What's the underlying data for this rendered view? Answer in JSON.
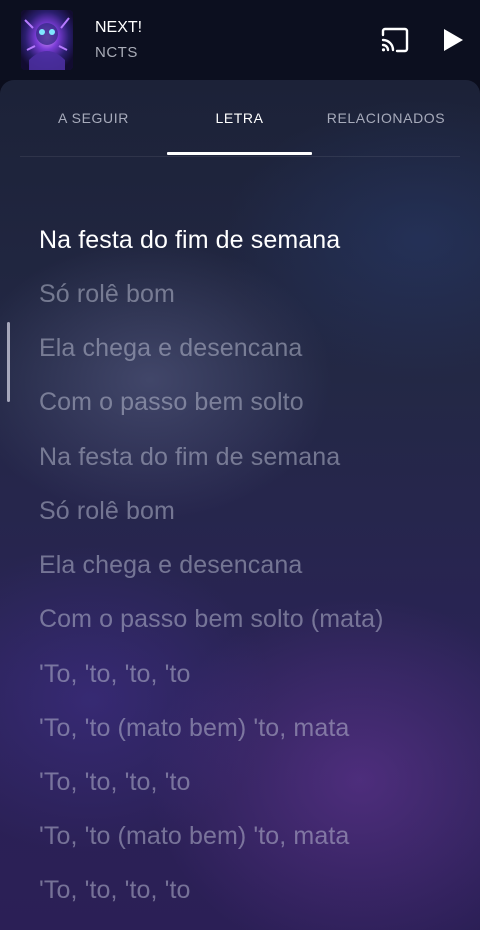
{
  "now_playing": {
    "title": "NEXT!",
    "artist": "NCTS"
  },
  "icons": {
    "cast": "cast-icon",
    "play": "play-icon"
  },
  "tabs": [
    {
      "label": "A SEGUIR",
      "active": false
    },
    {
      "label": "LETRA",
      "active": true
    },
    {
      "label": "RELACIONADOS",
      "active": false
    }
  ],
  "lyrics": [
    {
      "text": "Na festa do fim de semana",
      "current": true
    },
    {
      "text": "Só rolê bom",
      "current": false
    },
    {
      "text": "Ela chega e desencana",
      "current": false
    },
    {
      "text": "Com o passo bem solto",
      "current": false
    },
    {
      "text": "Na festa do fim de semana",
      "current": false
    },
    {
      "text": "Só rolê bom",
      "current": false
    },
    {
      "text": "Ela chega e desencana",
      "current": false
    },
    {
      "text": "Com o passo bem solto (mata)",
      "current": false
    },
    {
      "text": "'To, 'to, 'to, 'to",
      "current": false
    },
    {
      "text": "'To, 'to (mato bem) 'to, mata",
      "current": false
    },
    {
      "text": "'To, 'to, 'to, 'to",
      "current": false
    },
    {
      "text": "'To, 'to (mato bem) 'to, mata",
      "current": false
    },
    {
      "text": "'To, 'to, 'to, 'to",
      "current": false
    }
  ]
}
